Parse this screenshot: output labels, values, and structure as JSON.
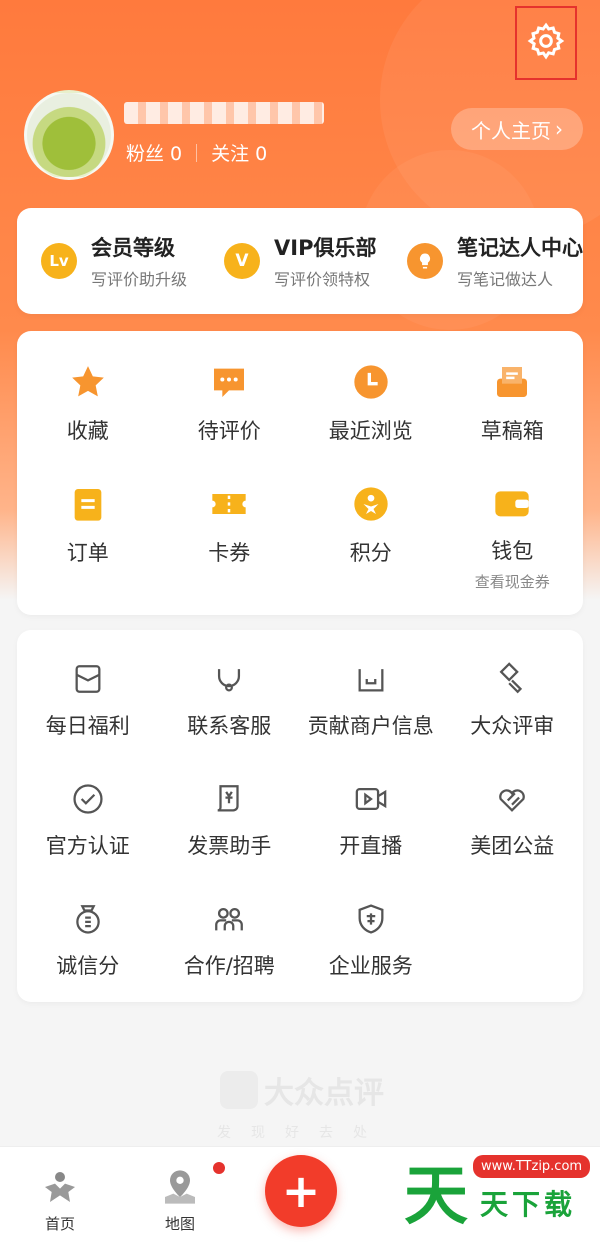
{
  "profile": {
    "fans_label": "粉丝 0",
    "follow_label": "关注 0",
    "homepage_label": "个人主页",
    "homepage_arrow": "›"
  },
  "member_row": [
    {
      "title": "会员等级",
      "subtitle": "写评价助升级",
      "icon": "lv-badge-icon",
      "icon_text": "Lv",
      "color": "#f7b21b"
    },
    {
      "title": "VIP俱乐部",
      "subtitle": "写评价领特权",
      "icon": "vip-badge-icon",
      "icon_text": "V",
      "color": "#f7b21b"
    },
    {
      "title": "笔记达人中心",
      "subtitle": "写笔记做达人",
      "icon": "bulb-icon",
      "icon_text": "",
      "color": "#f7952f"
    }
  ],
  "quick_grid": [
    {
      "label": "收藏",
      "icon": "star-icon"
    },
    {
      "label": "待评价",
      "icon": "comment-icon"
    },
    {
      "label": "最近浏览",
      "icon": "clock-icon"
    },
    {
      "label": "草稿箱",
      "icon": "drafts-icon"
    },
    {
      "label": "订单",
      "icon": "order-icon"
    },
    {
      "label": "卡券",
      "icon": "coupon-icon"
    },
    {
      "label": "积分",
      "icon": "points-icon"
    },
    {
      "label": "钱包",
      "icon": "wallet-icon",
      "sub": "查看现金券"
    }
  ],
  "service_grid": [
    {
      "label": "每日福利",
      "icon": "gift-envelope-icon"
    },
    {
      "label": "联系客服",
      "icon": "headset-icon"
    },
    {
      "label": "贡献商户信息",
      "icon": "shop-icon"
    },
    {
      "label": "大众评审",
      "icon": "gavel-icon"
    },
    {
      "label": "官方认证",
      "icon": "check-circle-icon"
    },
    {
      "label": "发票助手",
      "icon": "invoice-icon"
    },
    {
      "label": "开直播",
      "icon": "live-video-icon"
    },
    {
      "label": "美团公益",
      "icon": "heart-icon"
    },
    {
      "label": "诚信分",
      "icon": "credit-icon"
    },
    {
      "label": "合作/招聘",
      "icon": "team-icon"
    },
    {
      "label": "企业服务",
      "icon": "enterprise-shield-icon"
    }
  ],
  "watermark": {
    "logo_text": "大众点评",
    "slogan": "发现好去处"
  },
  "tabbar": {
    "home_label": "首页",
    "map_label": "地图",
    "add_symbol": "+"
  },
  "site_badge": {
    "big": "天",
    "url": "www.TTzip.com",
    "chars": "天下载"
  },
  "colors": {
    "accent": "#ff7a3d",
    "icon_orange": "#f7952f",
    "icon_yellow": "#f7b21b",
    "red": "#e5322d"
  }
}
